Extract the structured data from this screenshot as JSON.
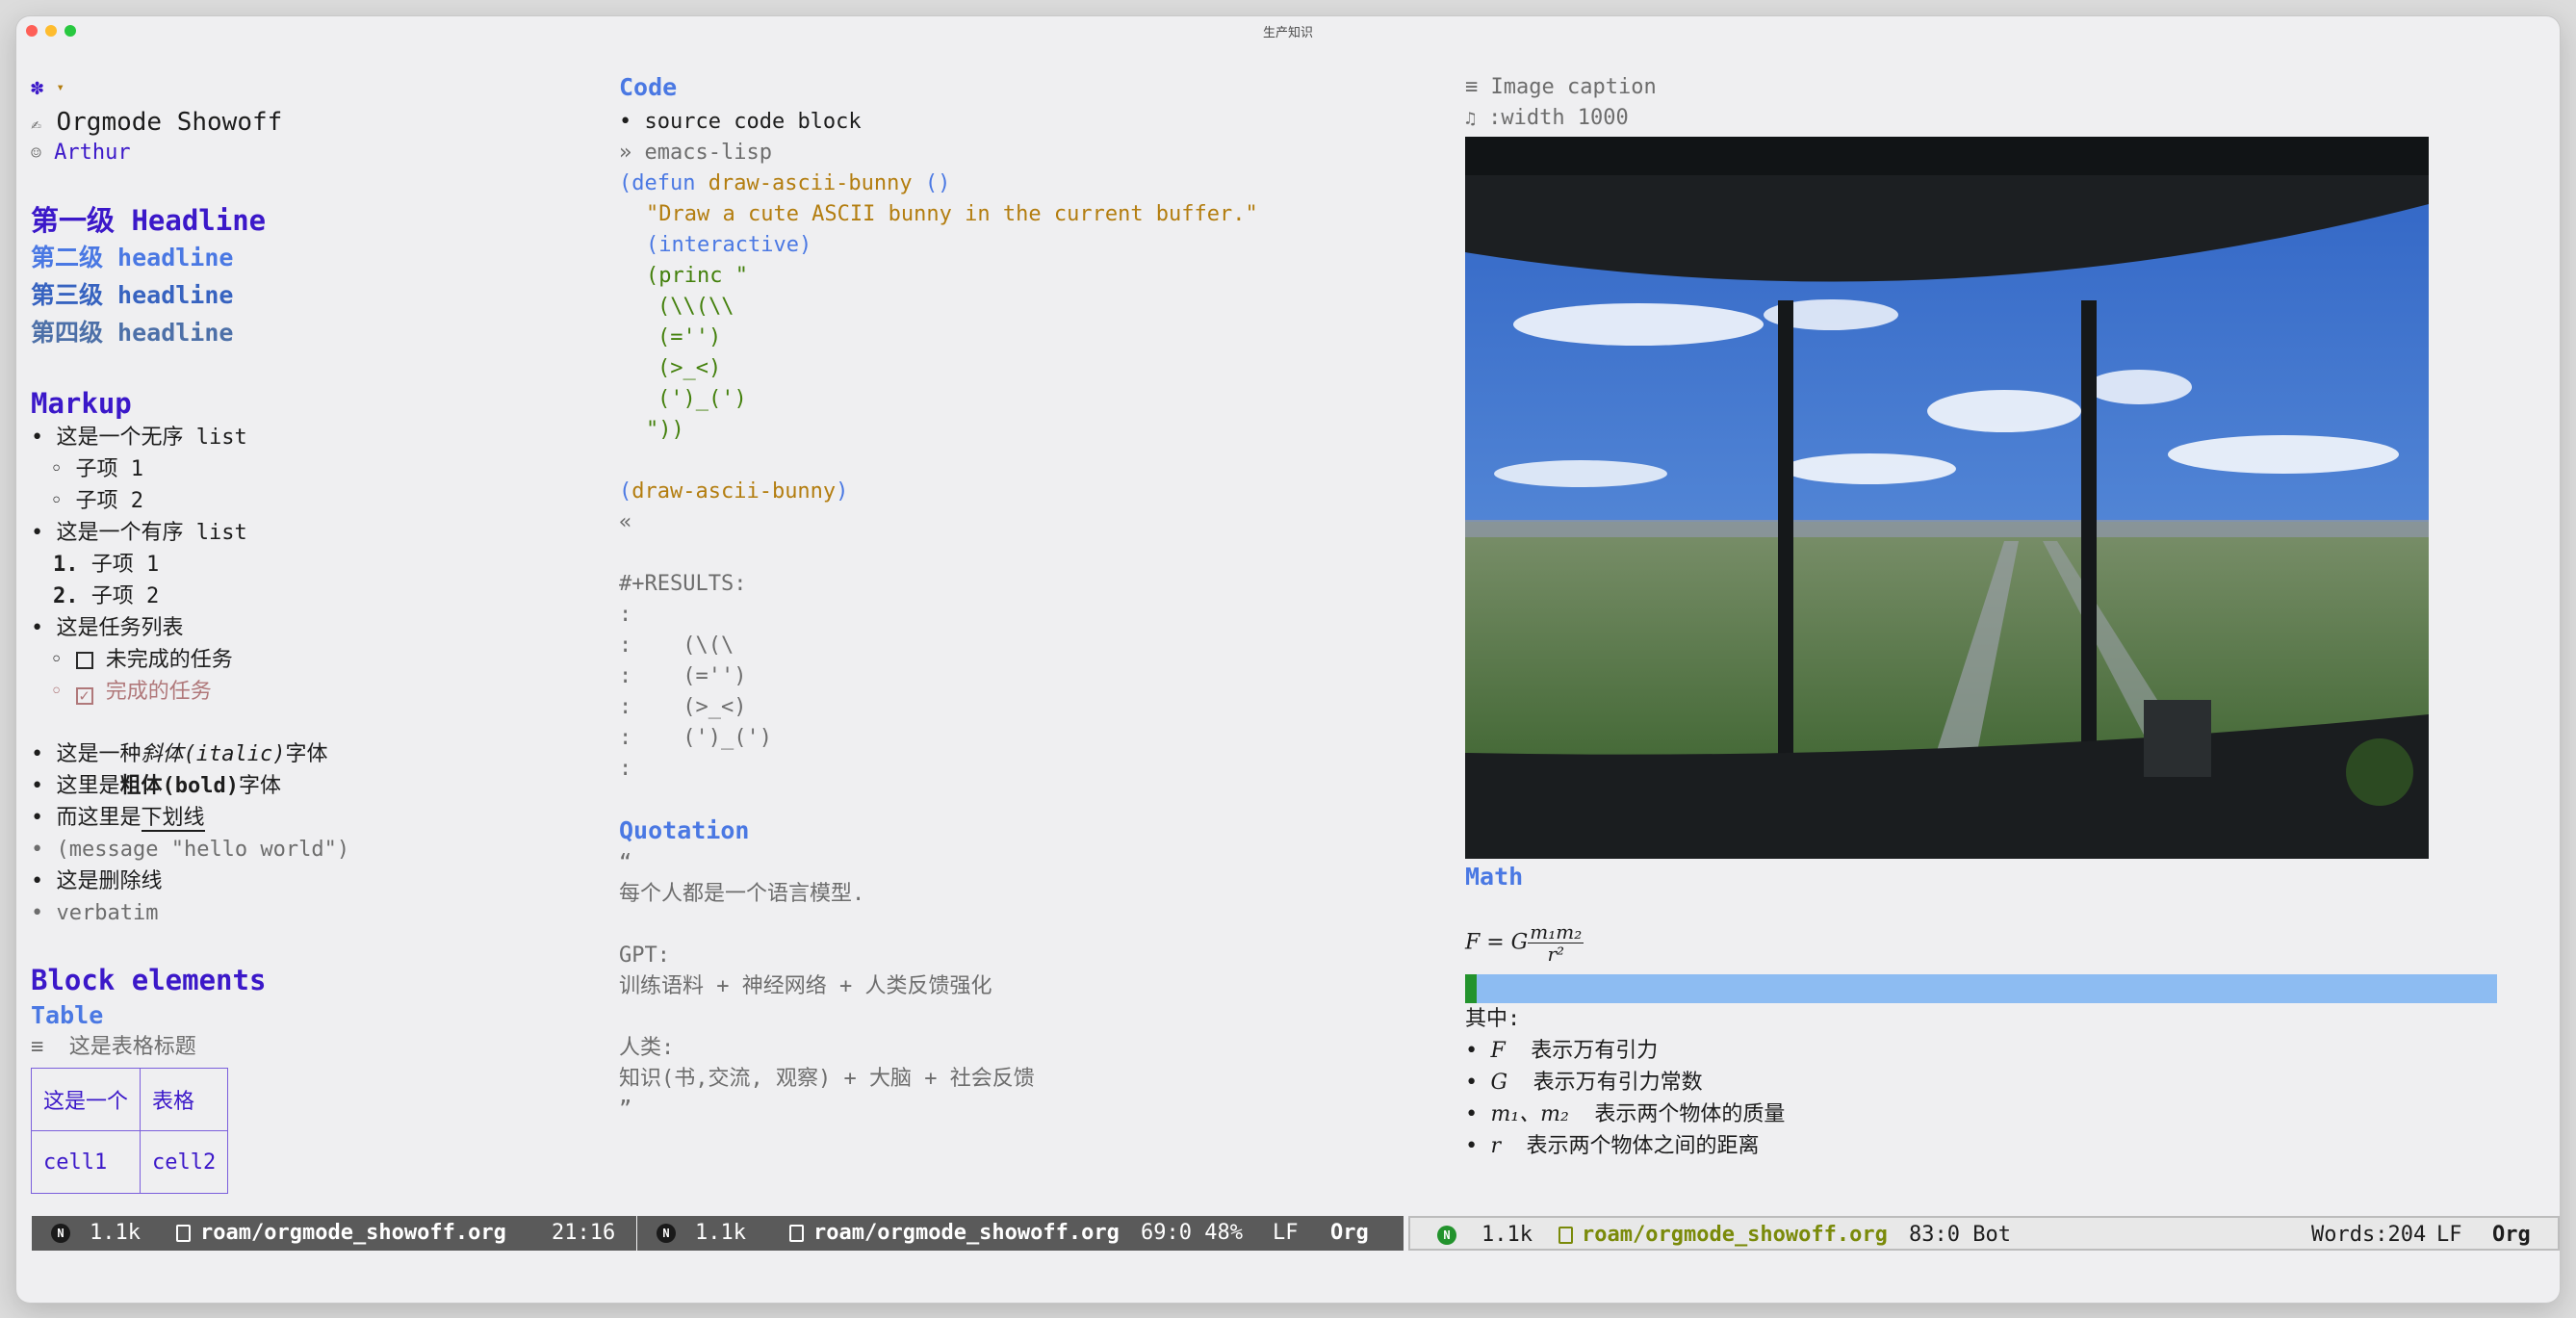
{
  "window": {
    "title": "生产知识"
  },
  "pane1": {
    "gear_icon_suffix": "▾",
    "doc_title": "Orgmode Showoff",
    "author": "Arthur",
    "headlines": [
      {
        "label": "第一级 Headline"
      },
      {
        "label": "第二级 headline"
      },
      {
        "label": "第三级 headline"
      },
      {
        "label": "第四级 headline"
      }
    ],
    "markup_heading": "Markup",
    "unordered_list": "这是一个无序 list",
    "sub_item_1": "子项 1",
    "sub_item_2": "子项 2",
    "ordered_list": "这是一个有序 list",
    "ordered_1_num": "1.",
    "ordered_1": "子项 1",
    "ordered_2_num": "2.",
    "ordered_2": "子项 2",
    "task_list": "这是任务列表",
    "task_undone": "未完成的任务",
    "task_done": "完成的任务",
    "italic_prefix": "这是一种",
    "italic_text": "斜体(italic)",
    "italic_suffix": "字体",
    "bold_prefix": "这里是",
    "bold_text": "粗体(bold)",
    "bold_suffix": "字体",
    "underline_prefix": "而这里是",
    "underline_text": "下划线",
    "code_inline": "(message \"hello world\")",
    "strike": "这是删除线",
    "verbatim": "verbatim",
    "block_heading": "Block elements",
    "table_heading": "Table",
    "table_caption": "这是表格标题",
    "table": [
      [
        "这是一个",
        "表格"
      ],
      [
        "cell1",
        "cell2"
      ]
    ]
  },
  "pane2": {
    "code_heading": "Code",
    "code_bullet": "source code block",
    "src_begin": "» emacs-lisp",
    "code_lines": {
      "defun": "defun",
      "fname": "draw-ascii-bunny",
      "args": "()",
      "docstring": "\"Draw a cute ASCII bunny in the current buffer.\"",
      "interactive": "(interactive)",
      "princ": "princ",
      "princ_quote": "\"",
      "bunny_1": "(\\\\(\\\\",
      "bunny_2": "(='')",
      "bunny_3": "(>_<)",
      "bunny_4": "(')_(')",
      "close": "\"))",
      "call": "draw-ascii-bunny"
    },
    "src_end": "«",
    "results_label": "#+RESULTS:",
    "results": [
      ":",
      ":    (\\(\\",
      ":    (='')",
      ":    (>_<)",
      ":    (')_(')",
      ":"
    ],
    "quote_heading": "Quotation",
    "quote_open": "“",
    "quote_line1": "每个人都是一个语言模型.",
    "quote_gpt": "GPT:",
    "quote_gpt_line": "训练语料 + 神经网络 + 人类反馈强化",
    "quote_human": "人类:",
    "quote_human_line": "知识(书,交流, 观察) + 大脑 + 社会反馈",
    "quote_close": "”"
  },
  "pane3": {
    "image_caption": "Image caption",
    "image_width": ":width 1000",
    "math_heading": "Math",
    "formula_lhs": "F = G",
    "formula_num": "m₁m₂",
    "formula_den": "r²",
    "progress": 0.01,
    "where_label": "其中:",
    "bullets": [
      {
        "sym": "F",
        "text": "表示万有引力"
      },
      {
        "sym": "G",
        "text": "表示万有引力常数"
      },
      {
        "sym": "m₁、m₂",
        "text": "表示两个物体的质量"
      },
      {
        "sym": "r",
        "text": "表示两个物体之间的距离"
      }
    ]
  },
  "modelines": [
    {
      "badge": "N",
      "size": "1.1k",
      "file": "roam/orgmode_showoff.org",
      "pos": "21:16"
    },
    {
      "badge": "N",
      "size": "1.1k",
      "file": "roam/orgmode_showoff.org",
      "pos": "69:0 48%",
      "eol": "LF",
      "mode": "Org"
    },
    {
      "badge": "N",
      "size": "1.1k",
      "file": "roam/orgmode_showoff.org",
      "pos": "83:0 Bot",
      "words": "Words:204",
      "eol": "LF",
      "mode": "Org"
    }
  ],
  "colors": {
    "accent": "#3b18c9",
    "blue": "#4a78e3",
    "badge_green": "#23932d",
    "file_olive": "#7a8a0a"
  }
}
